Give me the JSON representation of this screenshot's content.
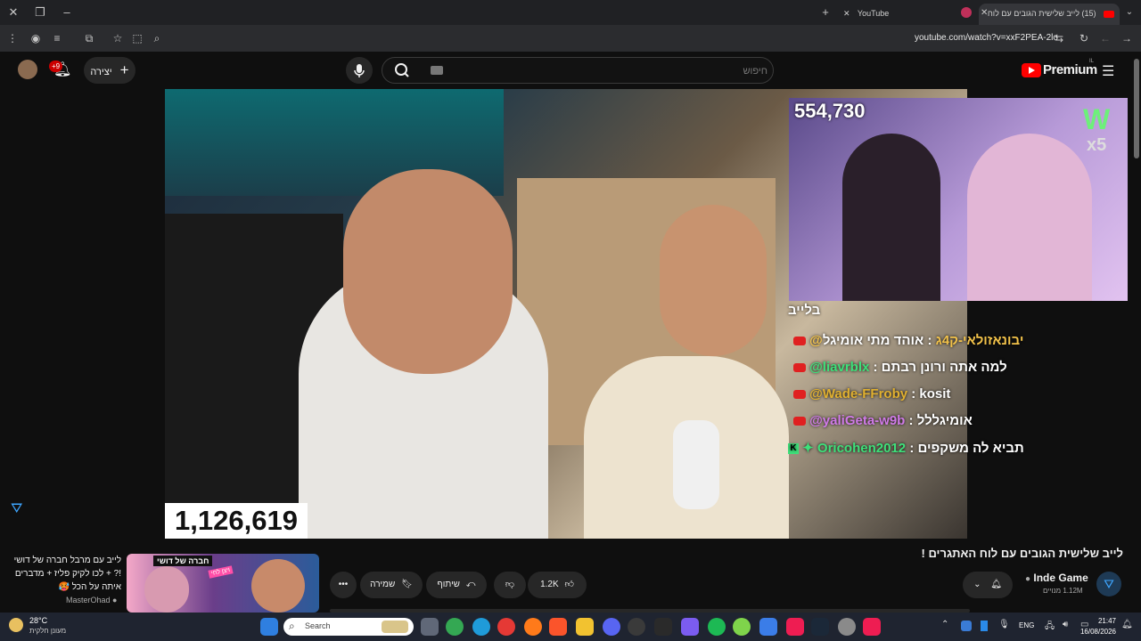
{
  "browser": {
    "tabs": [
      {
        "label": "(15) לייב שלישית הגובים עם לוח",
        "active": true
      },
      {
        "label": "YouTube",
        "active": false
      }
    ],
    "url": "youtube.com/watch?v=xxF2PEA-2lo"
  },
  "header": {
    "brand": "Premium",
    "brand_locale": "IL",
    "search_placeholder": "חיפוש",
    "create_label": "יצירה",
    "notifications_badge": "+9"
  },
  "video": {
    "viewer_count_main": "1,126,619",
    "viewer_count_pip": "554,730",
    "pip_badge_letter": "W",
    "pip_badge_mult": "x5",
    "chat_title": "בלייב",
    "chat": [
      {
        "user": "@יבונאזולאי-ק4ג",
        "text": "אוהד מתי אומיגל",
        "color": "#f2c24a"
      },
      {
        "user": "@liavrblx",
        "text": "למה אתה ורונן רבתם",
        "color": "#3ee07a"
      },
      {
        "user": "@Wade-FFroby",
        "text": "kosit",
        "color": "#e0b030"
      },
      {
        "user": "@yaliGeta-w9b",
        "text": "אומיגללל",
        "color": "#d07ae8"
      },
      {
        "user": "Oricohen2012",
        "text": "תביא לה משקפים",
        "color": "#3ee07a",
        "kick": true
      }
    ]
  },
  "below_video": {
    "title": "לייב שלישית הגובים עם לוח האתגרים !",
    "channel_name": "Inde Game",
    "subscribers": "1.12M מנויים",
    "likes": "1.2K",
    "share_label": "שיתוף",
    "save_label": "שמירה"
  },
  "recommended": {
    "title_line1": "לייב עם מרבל חברה של דושי",
    "title_line2": "!? + לכו לקיק פליז + מדברים",
    "title_line3": "איתה על הכל 🥵",
    "channel": "MasterOhad",
    "thumb_top": "חברה של דושי",
    "thumb_side": "ויצן לחי"
  },
  "taskbar": {
    "weather_temp": "28°C",
    "weather_desc": "מעונן חלקית",
    "search_label": "Search",
    "lang": "ENG",
    "time": "21:47",
    "date": "16/08/2026"
  },
  "colors": {
    "accent": "#ff0000",
    "chat_green": "#3ee07a",
    "chat_yellow": "#f2c24a"
  }
}
